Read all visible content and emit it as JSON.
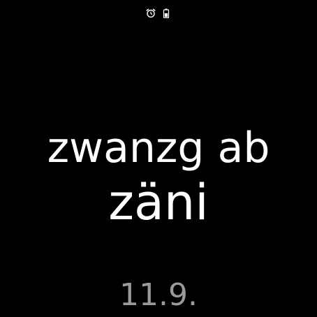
{
  "status": {
    "icons": [
      "alarm-clock-icon",
      "battery-icon"
    ]
  },
  "watch_face": {
    "time_line_1": "zwanzg ab",
    "time_line_2": "zäni",
    "date": "11.9."
  },
  "colors": {
    "background": "#000000",
    "time_text": "#ffffff",
    "date_text": "#9a9a9a"
  }
}
